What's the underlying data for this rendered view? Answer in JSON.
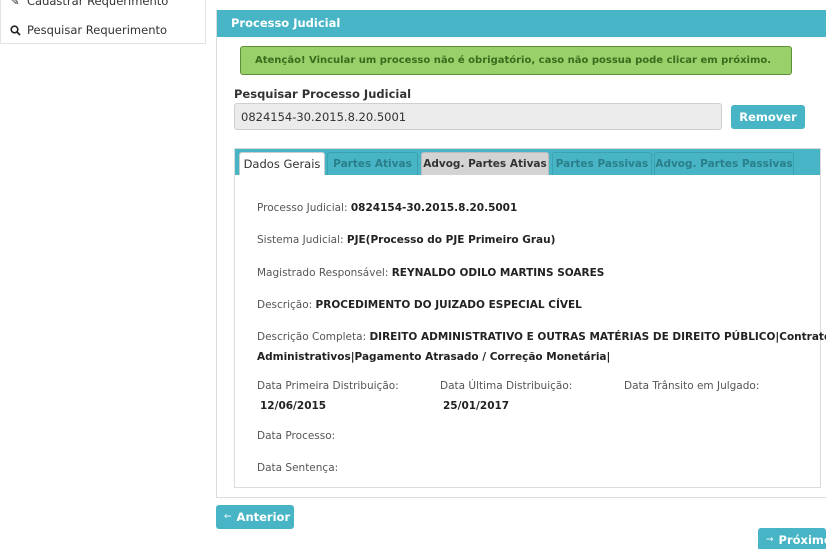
{
  "sidebar": {
    "items": [
      {
        "label": "Cadastrar Requerimento",
        "icon": "edit-icon"
      },
      {
        "label": "Pesquisar Requerimento",
        "icon": "search-icon"
      }
    ]
  },
  "panel": {
    "title": "Processo Judicial",
    "alert": "Atenção! Vincular um processo não é obrigatório, caso não possua pode clicar em próximo.",
    "search_label": "Pesquisar Processo Judicial",
    "search_value": "0824154-30.2015.8.20.5001",
    "remove_label": "Remover"
  },
  "tabs": [
    {
      "label": "Dados Gerais",
      "state": "active"
    },
    {
      "label": "Partes Ativas",
      "state": "teal"
    },
    {
      "label": "Advog. Partes Ativas",
      "state": "gray"
    },
    {
      "label": "Partes Passivas",
      "state": "teal"
    },
    {
      "label": "Advog. Partes Passivas",
      "state": "teal"
    }
  ],
  "details": {
    "processo_label": "Processo Judicial:",
    "processo_value": "0824154-30.2015.8.20.5001",
    "sistema_label": "Sistema Judicial:",
    "sistema_value": "PJE(Processo do PJE Primeiro Grau)",
    "magistrado_label": "Magistrado Responsável:",
    "magistrado_value": "REYNALDO ODILO MARTINS SOARES",
    "descricao_label": "Descrição:",
    "descricao_value": "PROCEDIMENTO DO JUIZADO ESPECIAL CÍVEL",
    "descricao_completa_label": "Descrição Completa:",
    "descricao_completa_value_1": "DIREITO ADMINISTRATIVO E OUTRAS MATÉRIAS DE DIREITO PÚBLICO|Contratos",
    "descricao_completa_value_2": "Administrativos|Pagamento Atrasado / Correção Monetária|",
    "primeira_distribuicao_label": "Data Primeira Distribuição:",
    "primeira_distribuicao_value": "12/06/2015",
    "ultima_distribuicao_label": "Data Última Distribuição:",
    "ultima_distribuicao_value": "25/01/2017",
    "transito_label": "Data Trânsito em Julgado:",
    "data_processo_label": "Data Processo:",
    "data_sentenca_label": "Data Sentença:"
  },
  "nav": {
    "previous_label": "Anterior",
    "next_label": "Próximo"
  },
  "colors": {
    "accent": "#47b5c5",
    "alert_bg": "#99d06a",
    "alert_text": "#3b6b1d"
  }
}
